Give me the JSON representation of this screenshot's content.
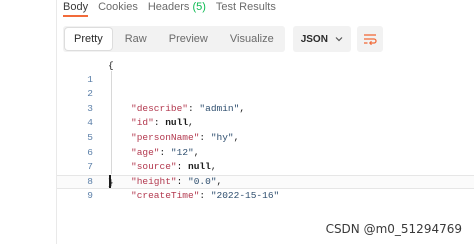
{
  "tabs": [
    {
      "label": "Body",
      "active": true
    },
    {
      "label": "Cookies",
      "active": false
    },
    {
      "label": "Headers",
      "count": "(5)",
      "active": false
    },
    {
      "label": "Test Results",
      "active": false
    }
  ],
  "view_modes": [
    {
      "label": "Pretty",
      "active": true
    },
    {
      "label": "Raw",
      "active": false
    },
    {
      "label": "Preview",
      "active": false
    },
    {
      "label": "Visualize",
      "active": false
    }
  ],
  "format_select": {
    "value": "JSON",
    "icon": "chevron-down-icon"
  },
  "wrap_button": {
    "icon": "wrap-lines-icon",
    "color": "#f26b3a"
  },
  "accent_color": "#f26b3a",
  "editor": {
    "line_numbers": [
      "1",
      "2",
      "3",
      "4",
      "5",
      "6",
      "7",
      "8",
      "9"
    ],
    "open_brace": "{",
    "close_brace": "}",
    "entries": [
      {
        "key": "\"describe\"",
        "value": "\"admin\"",
        "type": "string",
        "comma": ","
      },
      {
        "key": "\"id\"",
        "value": "null",
        "type": "null",
        "comma": ","
      },
      {
        "key": "\"personName\"",
        "value": "\"hy\"",
        "type": "string",
        "comma": ","
      },
      {
        "key": "\"age\"",
        "value": "\"12\"",
        "type": "string",
        "comma": ","
      },
      {
        "key": "\"source\"",
        "value": "null",
        "type": "null",
        "comma": ","
      },
      {
        "key": "\"height\"",
        "value": "\"0.0\"",
        "type": "string",
        "comma": ","
      },
      {
        "key": "\"createTime\"",
        "value": "\"2022-15-16\"",
        "type": "string",
        "comma": ""
      }
    ]
  },
  "watermark": "CSDN @m0_51294769"
}
